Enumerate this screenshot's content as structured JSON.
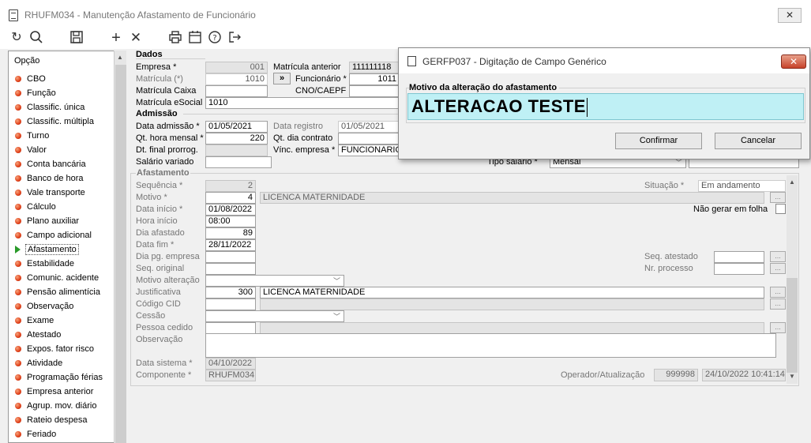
{
  "window": {
    "title": "RHUFM034 - Manutenção Afastamento de Funcionário",
    "close_label": "✕"
  },
  "toolbar": {
    "icons": [
      "refresh-icon",
      "search-icon",
      "save-icon",
      "add-icon",
      "delete-icon",
      "print-icon",
      "calendar-icon",
      "help-icon",
      "exit-icon"
    ]
  },
  "sidebar": {
    "header": "Opção",
    "items": [
      "CBO",
      "Função",
      "Classific. única",
      "Classific. múltipla",
      "Turno",
      "Valor",
      "Conta bancária",
      "Banco de hora",
      "Vale transporte",
      "Cálculo",
      "Plano auxiliar",
      "Campo adicional",
      "Afastamento",
      "Estabilidade",
      "Comunic. acidente",
      "Pensão alimentícia",
      "Observação",
      "Exame",
      "Atestado",
      "Expos. fator risco",
      "Atividade",
      "Programação férias",
      "Empresa anterior",
      "Agrup. mov. diário",
      "Rateio despesa",
      "Feriado"
    ],
    "selected": "Afastamento"
  },
  "dados": {
    "title": "Dados",
    "empresa_label": "Empresa *",
    "empresa": "001",
    "matricula_label": "Matrícula (*)",
    "matricula": "1010",
    "matricula_caixa_label": "Matrícula Caixa",
    "matricula_esocial_label": "Matrícula eSocial",
    "matricula_esocial": "1010",
    "matricula_anterior_label": "Matrícula anterior",
    "matricula_anterior": "111111118",
    "nav_button": "»",
    "funcionario_label": "Funcionário *",
    "funcionario": "1011",
    "cno_label": "CNO/CAEPF"
  },
  "admissao": {
    "title": "Admissão",
    "data_admissao_label": "Data admissão *",
    "data_admissao": "01/05/2021",
    "data_registro_label": "Data registro",
    "data_registro": "01/05/2021",
    "qt_hora_label": "Qt. hora mensal *",
    "qt_hora": "220",
    "qt_dia_label": "Qt. dia contrato",
    "dt_final_label": "Dt. final prorrog.",
    "vinc_label": "Vínc. empresa *",
    "vinc": "FUNCIONARIO",
    "salario_label": "Salário variado",
    "tipo_salario_label": "Tipo salário *",
    "tipo_salario": "Mensal"
  },
  "afastamento": {
    "title": "Afastamento",
    "sequencia_label": "Sequência *",
    "sequencia": "2",
    "situacao_label": "Situação *",
    "situacao": "Em andamento",
    "motivo_label": "Motivo *",
    "motivo": "4",
    "motivo_desc": "LICENCA MATERNIDADE",
    "data_inicio_label": "Data início *",
    "data_inicio": "01/08/2022",
    "nao_gerar_label": "Não gerar em folha",
    "hora_inicio_label": "Hora início",
    "hora_inicio": "08:00",
    "dia_afastado_label": "Dia afastado",
    "dia_afastado": "89",
    "data_fim_label": "Data fim *",
    "data_fim": "28/11/2022",
    "dia_pg_label": "Dia pg. empresa",
    "seq_atestado_label": "Seq. atestado",
    "seq_original_label": "Seq. original",
    "nr_processo_label": "Nr. processo",
    "motivo_alt_label": "Motivo alteração",
    "justificativa_label": "Justificativa",
    "justificativa": "300",
    "justificativa_desc": "LICENCA MATERNIDADE",
    "codigo_cid_label": "Código CID",
    "cessao_label": "Cessão",
    "pessoa_cedido_label": "Pessoa cedido",
    "observacao_label": "Observação",
    "data_sistema_label": "Data sistema *",
    "data_sistema": "04/10/2022",
    "componente_label": "Componente *",
    "componente": "RHUFM034",
    "operador_label": "Operador/Atualização",
    "operador": "999998",
    "atualizacao": "24/10/2022 10:41:14"
  },
  "dialog": {
    "title": "GERFP037 - Digitação de Campo Genérico",
    "close_label": "✕",
    "field_label": "Motivo da alteração do afastamento",
    "field_value": "ALTERACAO TESTE",
    "confirm": "Confirmar",
    "cancel": "Cancelar"
  }
}
